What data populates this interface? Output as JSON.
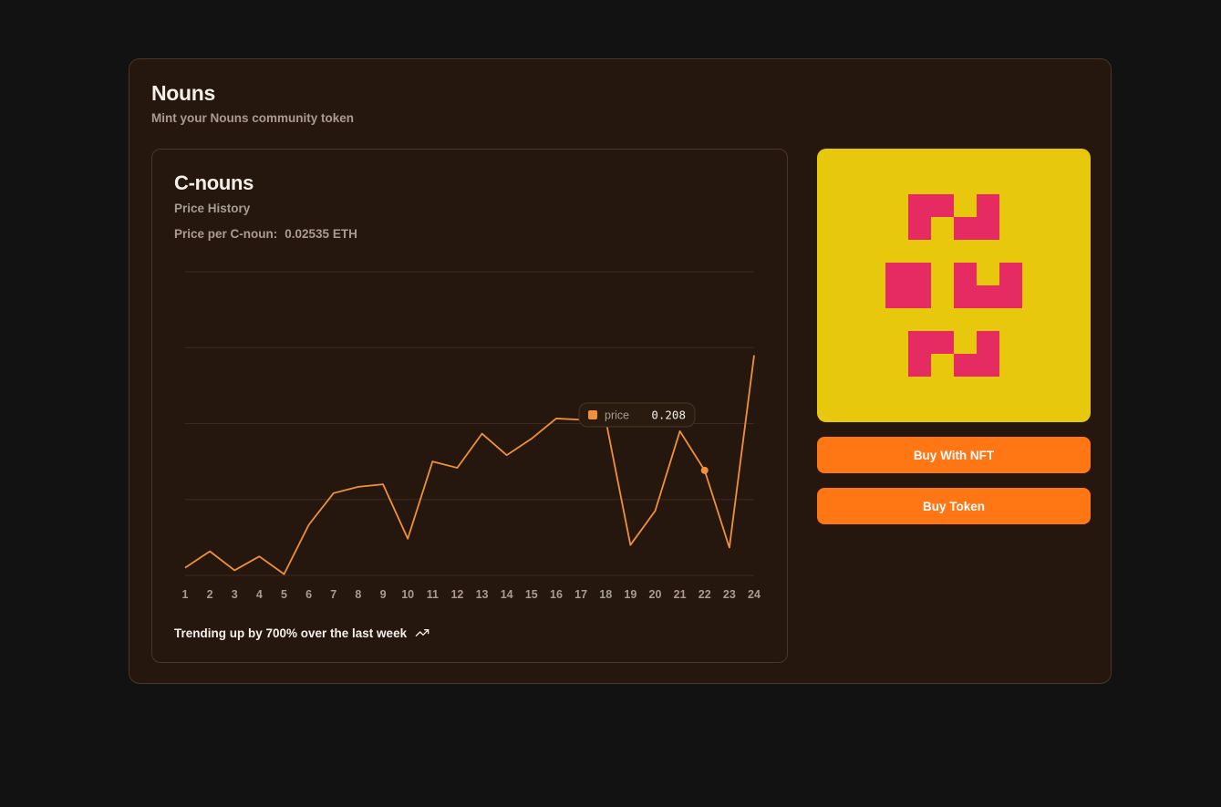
{
  "page": {
    "title": "Nouns",
    "subtitle": "Mint your Nouns community token"
  },
  "card": {
    "title": "C-nouns",
    "subtitle": "Price History",
    "price_label": "Price per C-noun:",
    "price_value": "0.02535 ETH",
    "trend_text": "Trending up by 700% over the last week",
    "trend_icon": "trending-up-icon"
  },
  "tooltip": {
    "series": "price",
    "value": "0.208",
    "active_x": 22
  },
  "buttons": {
    "buy_nft": "Buy With NFT",
    "buy_token": "Buy Token"
  },
  "colors": {
    "accent": "#ff7615",
    "line": "#f0913a",
    "nft_background": "#e8c80c",
    "nft_glyph": "#e62a62"
  },
  "chart_data": {
    "type": "line",
    "x": [
      1,
      2,
      3,
      4,
      5,
      6,
      7,
      8,
      9,
      10,
      11,
      12,
      13,
      14,
      15,
      16,
      17,
      18,
      19,
      20,
      21,
      22,
      23,
      24
    ],
    "series": [
      {
        "name": "price",
        "values": [
          0.03,
          0.095,
          0.02,
          0.075,
          0.005,
          0.2,
          0.325,
          0.35,
          0.36,
          0.145,
          0.45,
          0.425,
          0.56,
          0.475,
          0.54,
          0.62,
          0.615,
          0.615,
          0.12,
          0.255,
          0.57,
          0.415,
          0.11,
          0.87
        ]
      }
    ],
    "ylim": [
      0,
      1.2
    ],
    "grid": true
  }
}
